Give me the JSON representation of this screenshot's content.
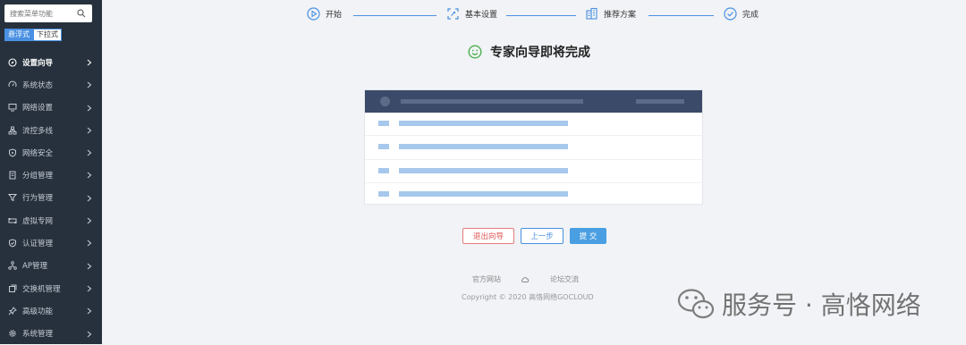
{
  "sidebar": {
    "search": {
      "placeholder": "搜索菜单功能",
      "value": ""
    },
    "mode": {
      "tabs": [
        "悬浮式",
        "下拉式"
      ],
      "active": "悬浮式"
    },
    "items": [
      {
        "label": "设置向导",
        "icon": "compass-icon",
        "active": true
      },
      {
        "label": "系统状态",
        "icon": "gauge-icon"
      },
      {
        "label": "网络设置",
        "icon": "monitor-icon"
      },
      {
        "label": "流控多线",
        "icon": "network-icon"
      },
      {
        "label": "网络安全",
        "icon": "shield-icon"
      },
      {
        "label": "分组管理",
        "icon": "document-icon"
      },
      {
        "label": "行为管理",
        "icon": "filter-icon"
      },
      {
        "label": "虚拟专网",
        "icon": "vpn-icon"
      },
      {
        "label": "认证管理",
        "icon": "shield-check-icon"
      },
      {
        "label": "AP管理",
        "icon": "ap-icon"
      },
      {
        "label": "交换机管理",
        "icon": "switch-icon"
      },
      {
        "label": "高级功能",
        "icon": "pin-icon"
      },
      {
        "label": "系统管理",
        "icon": "gear-icon"
      }
    ]
  },
  "wizard": {
    "steps": [
      {
        "label": "开始",
        "icon": "play-icon"
      },
      {
        "label": "基本设置",
        "icon": "settings-icon"
      },
      {
        "label": "推荐方案",
        "icon": "building-icon"
      },
      {
        "label": "完成",
        "icon": "check-circle-icon"
      }
    ],
    "title": "专家向导即将完成",
    "buttons": {
      "exit": "退出向导",
      "prev": "上一步",
      "submit": "提 交"
    }
  },
  "footer": {
    "link_official": "官方网站",
    "link_forum": "论坛交流",
    "copyright": "Copyright © 2020 高恪网络GOCLOUD"
  },
  "watermark": "服务号 · 高恪网络",
  "colors": {
    "accent": "#4a90e2",
    "sidebar_bg": "#27313d",
    "danger": "#e05555",
    "success": "#4caf50"
  }
}
